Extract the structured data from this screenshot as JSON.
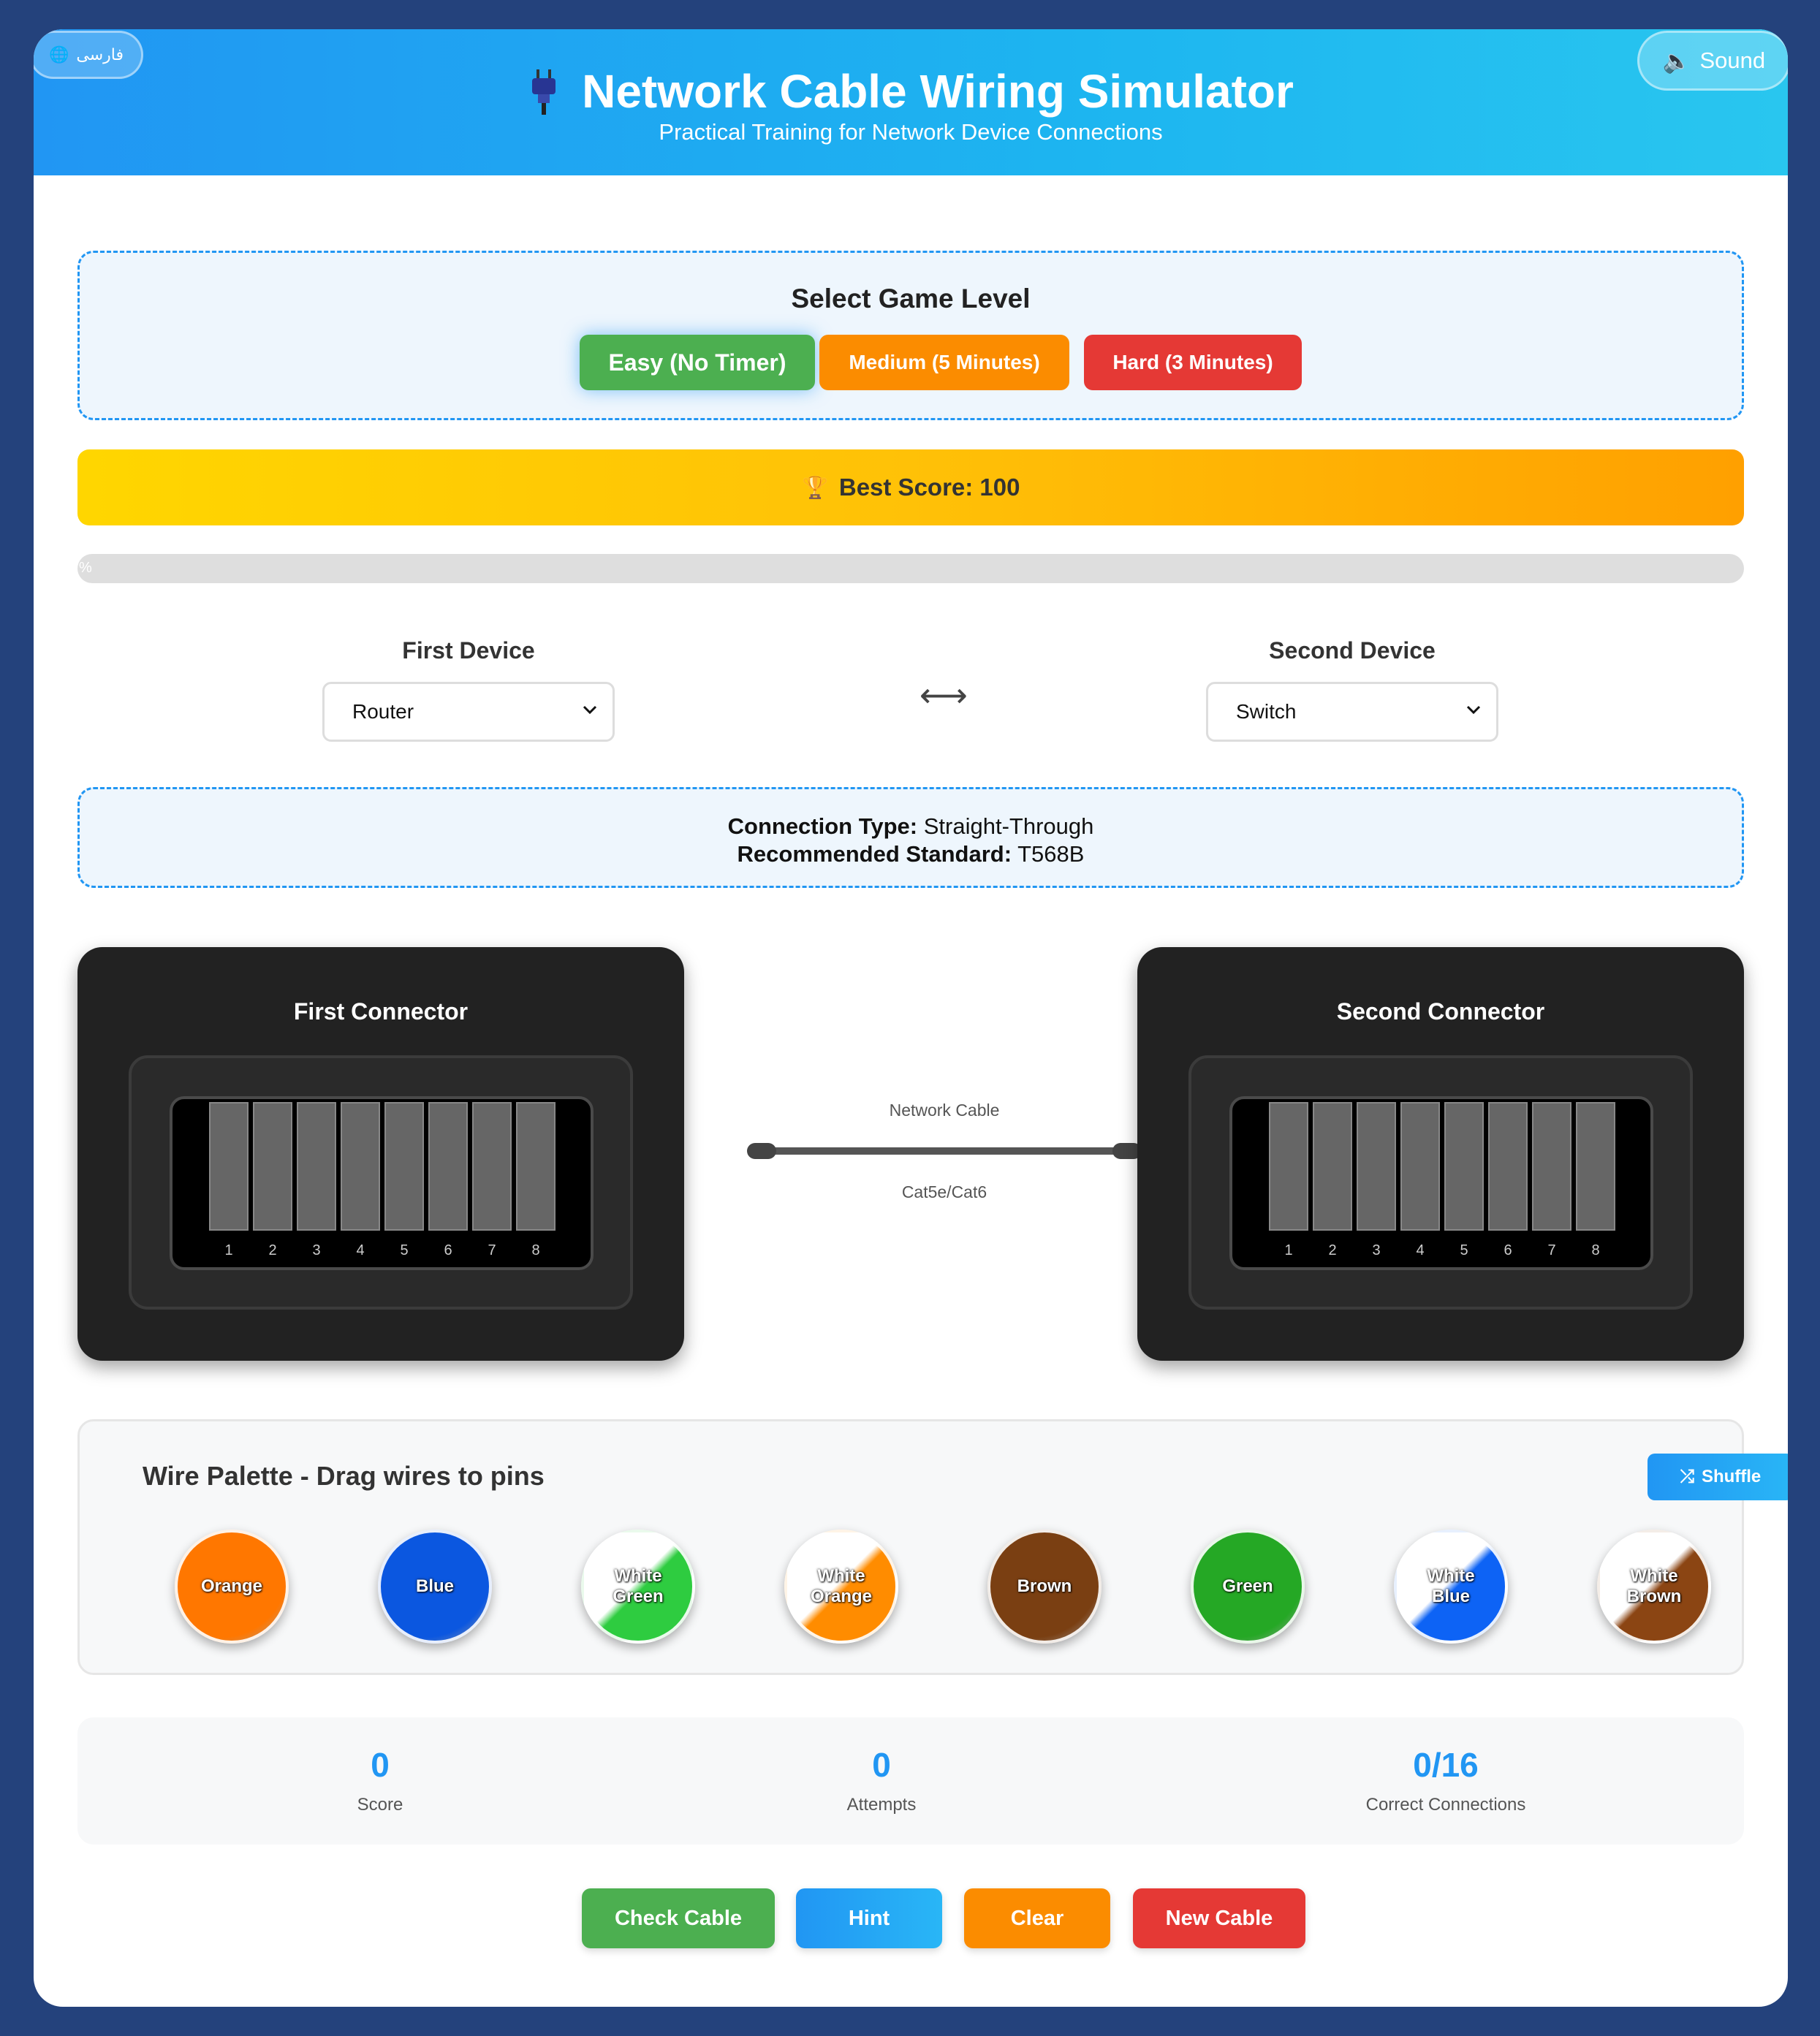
{
  "header": {
    "title": "Network Cable Wiring Simulator",
    "subtitle": "Practical Training for Network Device Connections",
    "language_button": "فارسی",
    "sound_button": "Sound",
    "gradient_colors": [
      "#2196f3",
      "#29c6ef"
    ]
  },
  "levels": {
    "title": "Select Game Level",
    "options": [
      {
        "label": "Easy (No Timer)",
        "color": "#4caf50",
        "selected": true
      },
      {
        "label": "Medium (5 Minutes)",
        "color": "#fb8c00",
        "selected": false
      },
      {
        "label": "Hard (3 Minutes)",
        "color": "#e53935",
        "selected": false
      }
    ]
  },
  "best_score": {
    "label": "Best Score: 100"
  },
  "progress": {
    "value_percent": 0,
    "text": "%"
  },
  "devices": {
    "first": {
      "label": "First Device",
      "selected": "Router"
    },
    "second": {
      "label": "Second Device",
      "selected": "Switch"
    },
    "link_symbol": "⟷"
  },
  "connection": {
    "type_label": "Connection Type:",
    "type_value": "Straight-Through",
    "standard_label": "Recommended Standard:",
    "standard_value": "T568B"
  },
  "connectors": [
    {
      "title": "First Connector",
      "pins": [
        "1",
        "2",
        "3",
        "4",
        "5",
        "6",
        "7",
        "8"
      ]
    },
    {
      "title": "Second Connector",
      "pins": [
        "1",
        "2",
        "3",
        "4",
        "5",
        "6",
        "7",
        "8"
      ]
    }
  ],
  "cable": {
    "top_label": "Network Cable",
    "bottom_label": "Cat5e/Cat6"
  },
  "palette": {
    "title": "Wire Palette - Drag wires to pins",
    "shuffle_label": "Shuffle",
    "wires": [
      {
        "line1": "Orange",
        "line2": "",
        "color": "#ff7700",
        "stripe": false
      },
      {
        "line1": "Blue",
        "line2": "",
        "color": "#0b57e0",
        "stripe": false
      },
      {
        "line1": "White",
        "line2": "Green",
        "color": "#2ecc40",
        "stripe": true
      },
      {
        "line1": "White",
        "line2": "Orange",
        "color": "#ff8c00",
        "stripe": true
      },
      {
        "line1": "Brown",
        "line2": "",
        "color": "#7a3f12",
        "stripe": false
      },
      {
        "line1": "Green",
        "line2": "",
        "color": "#25a825",
        "stripe": false
      },
      {
        "line1": "White",
        "line2": "Blue",
        "color": "#0d63f5",
        "stripe": true
      },
      {
        "line1": "White",
        "line2": "Brown",
        "color": "#8b4513",
        "stripe": true
      }
    ]
  },
  "stats": {
    "score": {
      "value": "0",
      "label": "Score"
    },
    "attempts": {
      "value": "0",
      "label": "Attempts"
    },
    "correct": {
      "value": "0/16",
      "label": "Correct Connections"
    }
  },
  "actions": {
    "check": "Check Cable",
    "hint": "Hint",
    "clear": "Clear",
    "new": "New Cable"
  }
}
